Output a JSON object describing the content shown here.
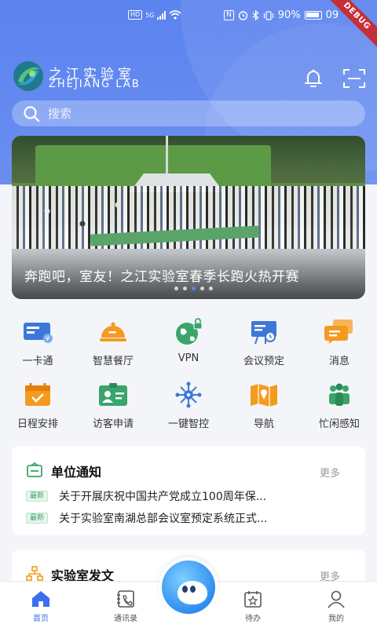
{
  "status_bar": {
    "hd": "HD",
    "net": "5G",
    "nfc": "N",
    "battery_pct": "90%",
    "time": "09",
    "debug_label": "DEBUG"
  },
  "brand": {
    "name_cn": "之江实验室",
    "name_en": "ZHEJIANG LAB"
  },
  "search": {
    "placeholder": "搜索"
  },
  "banner": {
    "caption": "奔跑吧，室友！之江实验室春季长跑火热开赛",
    "slide_count": 5,
    "active_slide": 2
  },
  "grid": {
    "items": [
      {
        "label": "一卡通",
        "icon": "card-icon"
      },
      {
        "label": "智慧餐厅",
        "icon": "dining-icon"
      },
      {
        "label": "VPN",
        "icon": "vpn-globe-icon"
      },
      {
        "label": "会议预定",
        "icon": "meeting-board-icon"
      },
      {
        "label": "消息",
        "icon": "message-icon"
      },
      {
        "label": "日程安排",
        "icon": "calendar-icon"
      },
      {
        "label": "访客申请",
        "icon": "visitor-badge-icon"
      },
      {
        "label": "一键智控",
        "icon": "smart-control-icon"
      },
      {
        "label": "导航",
        "icon": "map-icon"
      },
      {
        "label": "忙闲感知",
        "icon": "people-icon"
      }
    ]
  },
  "notices_card": {
    "title": "单位通知",
    "more": "更多",
    "items": [
      {
        "tag": "最新",
        "text": "关于开展庆祝中国共产党成立100周年保..."
      },
      {
        "tag": "最新",
        "text": "关于实验室南湖总部会议室预定系统正式..."
      }
    ]
  },
  "documents_card": {
    "title": "实验室发文",
    "more": "更多"
  },
  "tabbar": {
    "tabs": [
      {
        "label": "首页",
        "active": true
      },
      {
        "label": "通讯录",
        "active": false
      },
      {
        "label": "待办",
        "active": false
      },
      {
        "label": "我的",
        "active": false
      }
    ]
  },
  "colors": {
    "header_blue": "#5b83ef",
    "active_tab": "#3a6ff0",
    "orange": "#f39a1f",
    "green": "#3aa56a",
    "blue_icon": "#3d78d8"
  }
}
